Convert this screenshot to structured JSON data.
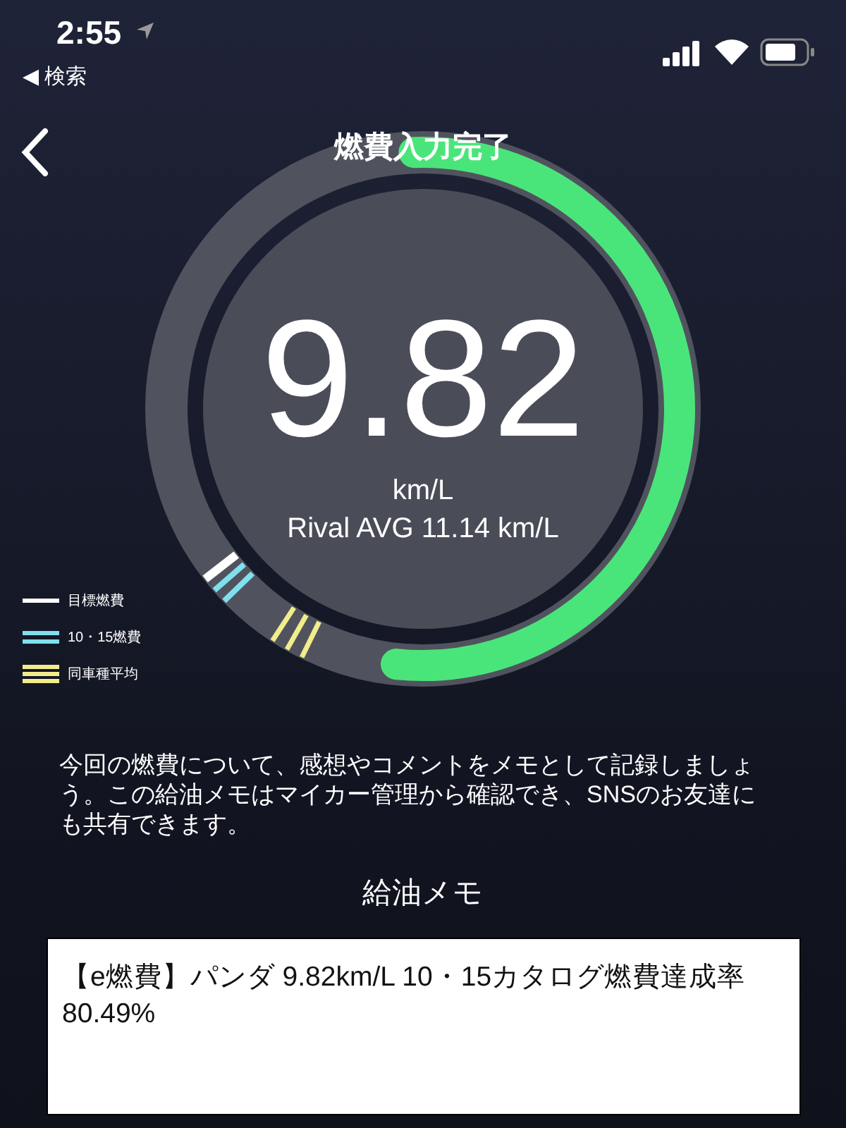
{
  "status_bar": {
    "time": "2:55",
    "back_app": "◀ 検索"
  },
  "nav": {
    "title": "燃費入力完了"
  },
  "gauge": {
    "value": "9.82",
    "unit": "km/L",
    "rival": "Rival AVG 11.14 km/L"
  },
  "legend": [
    {
      "kind": "single",
      "label": "目標燃費",
      "color": "#ffffff"
    },
    {
      "kind": "double",
      "label": "10・15燃費",
      "color": "#7fe0ee"
    },
    {
      "kind": "triple",
      "label": "同車種平均",
      "color": "#f2ec8a"
    }
  ],
  "description": "今回の燃費について、感想やコメントをメモとして記録しましょう。この給油メモはマイカー管理から確認でき、SNSのお友達にも共有できます。",
  "memo": {
    "heading": "給油メモ",
    "value": "【e燃費】パンダ 9.82km/L 10・15カタログ燃費達成率80.49%"
  }
}
